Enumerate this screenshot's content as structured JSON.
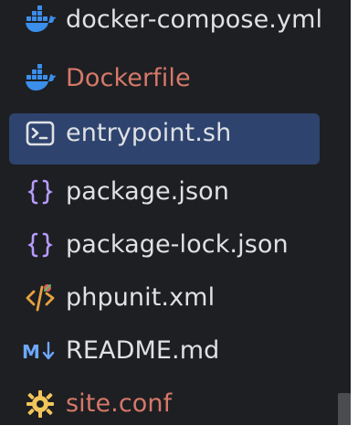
{
  "project_tree": {
    "items": [
      {
        "label": "docker-compose.yml",
        "icon": "docker-icon",
        "git_status": "none"
      },
      {
        "label": "Dockerfile",
        "icon": "docker-icon",
        "git_status": "modified"
      },
      {
        "label": "entrypoint.sh",
        "icon": "terminal-icon",
        "git_status": "none",
        "selected": true
      },
      {
        "label": "package.json",
        "icon": "json-braces-icon",
        "git_status": "none"
      },
      {
        "label": "package-lock.json",
        "icon": "json-braces-icon",
        "git_status": "none"
      },
      {
        "label": "phpunit.xml",
        "icon": "xml-tag-icon",
        "git_status": "none"
      },
      {
        "label": "README.md",
        "icon": "markdown-icon",
        "git_status": "none"
      },
      {
        "label": "site.conf",
        "icon": "gear-config-icon",
        "git_status": "modified"
      }
    ]
  },
  "colors": {
    "background": "#1E1F22",
    "selection": "#2E436E",
    "text": "#DFE1E5",
    "modified_text": "#D6786A",
    "docker_blue": "#3B8EEA",
    "json_purple": "#B79CFF",
    "xml_orange": "#E8A23F",
    "xml_red": "#E05D5D",
    "markdown_blue": "#6EA8FE",
    "config_yellow": "#F2C55C"
  }
}
